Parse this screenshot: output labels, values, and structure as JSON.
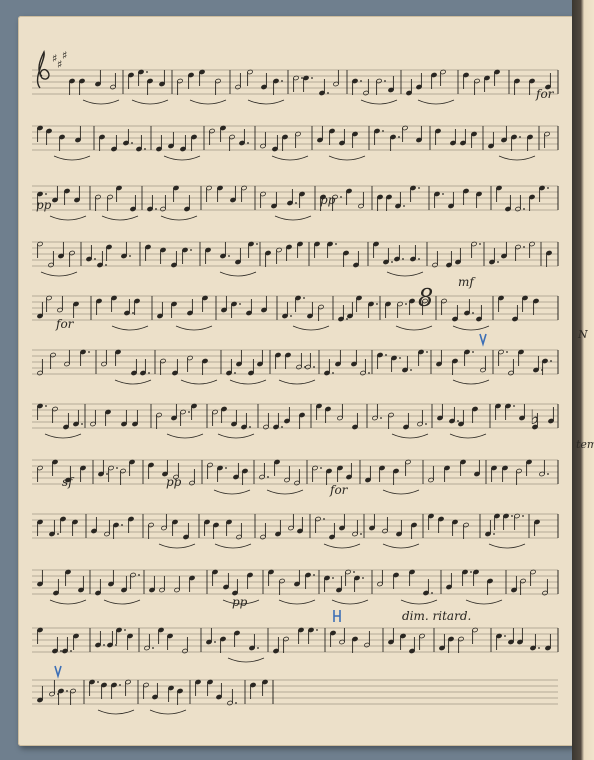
{
  "document": {
    "type": "handwritten music manuscript",
    "clef": "treble",
    "key_signature": "3 sharps (A major)",
    "staff_count": 12
  },
  "directions": {
    "for_1": "for",
    "pp_1": "pp",
    "pp_2": "pp",
    "for_2": "for",
    "mf": "mf",
    "sf": "sf",
    "pp_3": "pp",
    "for_3": "for",
    "pp_4": "pp",
    "dim_ritard": "dim. ritard."
  },
  "margin_fragments": {
    "right_1": "N",
    "right_2": "tem"
  },
  "colors": {
    "paper": "#ece0c9",
    "ink": "#2a2722",
    "blue_pencil": "#3d6fb6",
    "background": "#6f7f8e"
  }
}
